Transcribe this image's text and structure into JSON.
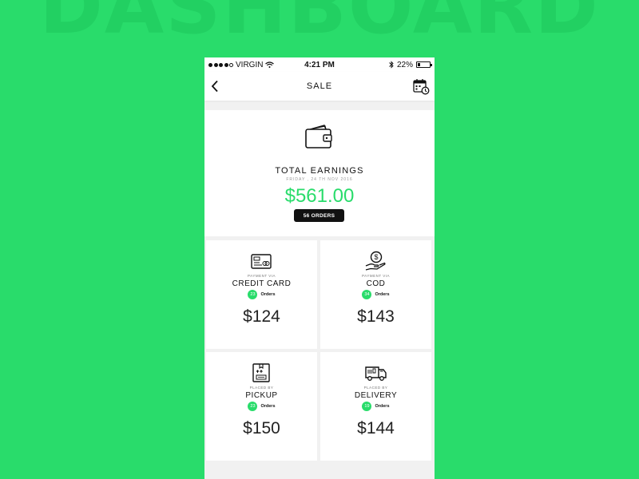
{
  "background": {
    "title": "DASHBOARD",
    "color": "#29dc6b"
  },
  "status_bar": {
    "carrier": "VIRGIN",
    "time": "4:21 PM",
    "battery": "22%",
    "battery_level": 0.22
  },
  "nav": {
    "title": "SALE",
    "back_icon": "chevron-left-icon",
    "action_icon": "calendar-clock-icon"
  },
  "earnings": {
    "icon": "wallet-icon",
    "title": "TOTAL EARNINGS",
    "date": "FRIDAY , 24 TH NOV 2016",
    "amount": "$561.00",
    "orders_label": "56 ORDERS"
  },
  "tiles": [
    {
      "icon": "credit-card-icon",
      "caption": "PAYMENT VIA",
      "label": "CREDIT CARD",
      "orders_count": "23",
      "orders_word": "Orders",
      "amount": "$124"
    },
    {
      "icon": "cash-hand-icon",
      "caption": "PAYMENT VIA",
      "label": "COD",
      "orders_count": "34",
      "orders_word": "Orders",
      "amount": "$143"
    },
    {
      "icon": "package-box-icon",
      "caption": "PLACED BY",
      "label": "PICKUP",
      "orders_count": "23",
      "orders_word": "Orders",
      "amount": "$150"
    },
    {
      "icon": "delivery-truck-icon",
      "caption": "PLACED BY",
      "label": "DELIVERY",
      "orders_count": "19",
      "orders_word": "Orders",
      "amount": "$144"
    }
  ],
  "colors": {
    "accent": "#29dc6b",
    "dark": "#111111"
  }
}
